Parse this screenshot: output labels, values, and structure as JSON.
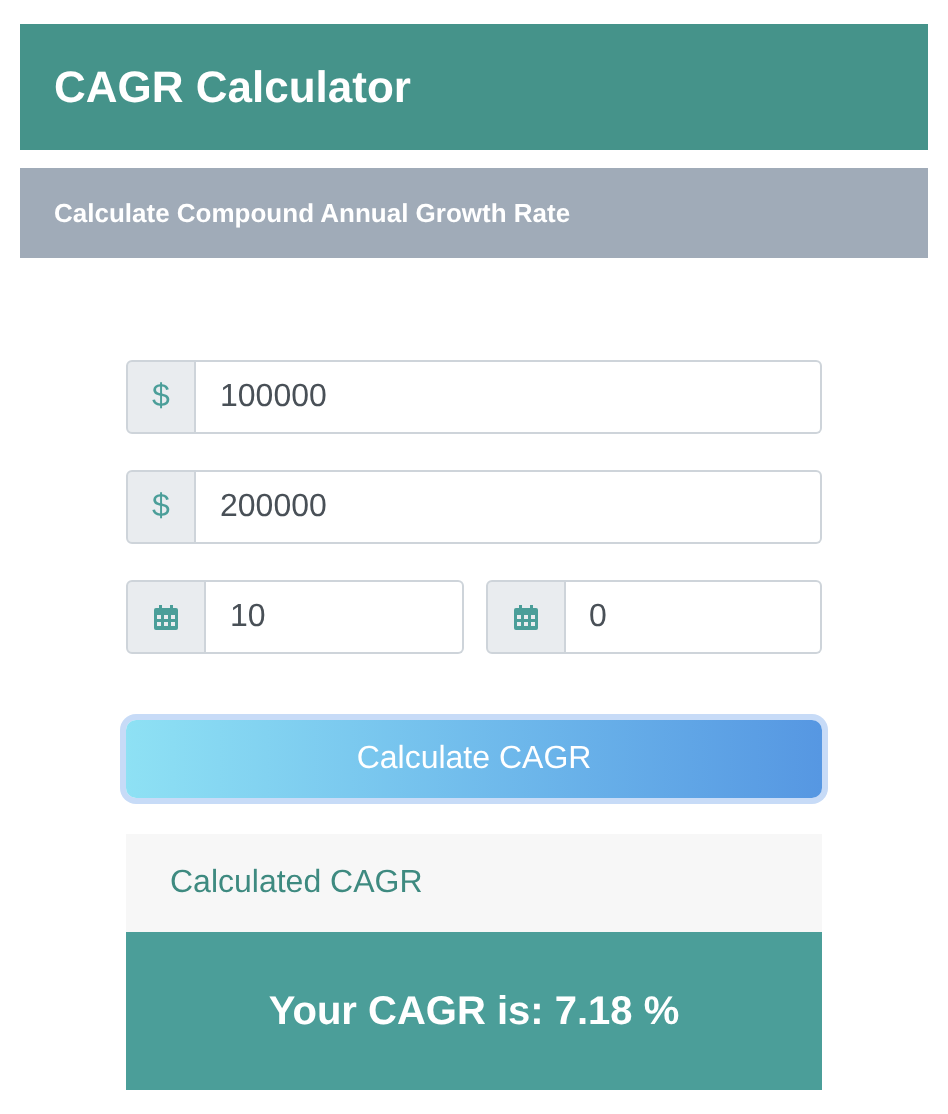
{
  "header": {
    "title": "CAGR Calculator"
  },
  "subheader": {
    "text": "Calculate Compound Annual Growth Rate"
  },
  "field_rows": [
    [
      {
        "kind": "currency",
        "prefix": "$",
        "value": "100000"
      }
    ],
    [
      {
        "kind": "currency",
        "prefix": "$",
        "value": "200000"
      }
    ],
    [
      {
        "kind": "calendar",
        "value": "10"
      },
      {
        "kind": "calendar",
        "value": "0"
      }
    ]
  ],
  "calculate_button": {
    "label": "Calculate CAGR"
  },
  "result_card": {
    "title": "Calculated CAGR",
    "result": "Your CAGR is: 7.18 %"
  }
}
